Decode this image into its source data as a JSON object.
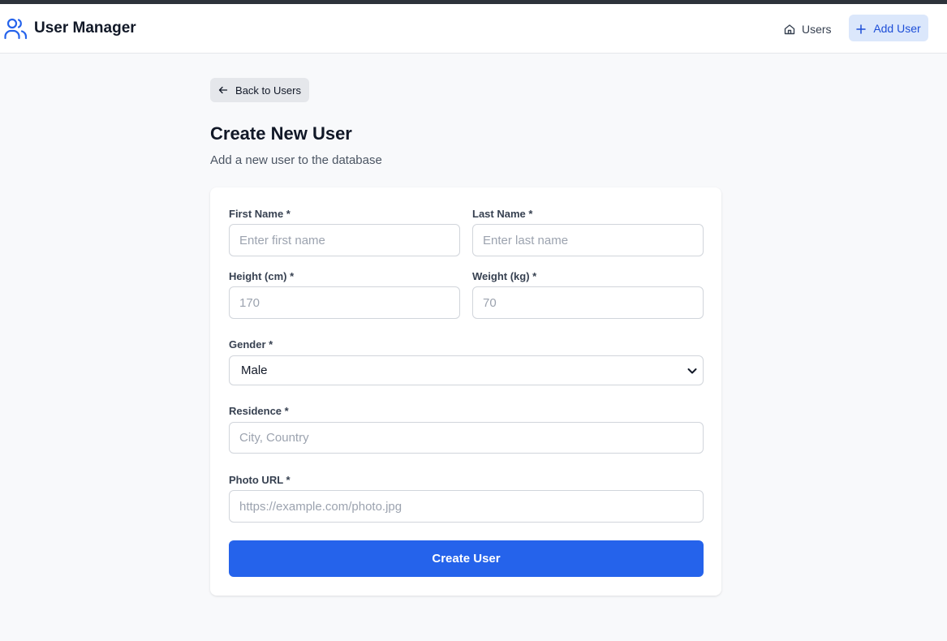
{
  "app": {
    "title": "User Manager"
  },
  "nav": {
    "users_label": "Users",
    "add_user_label": "Add User"
  },
  "page": {
    "back_label": "Back to Users",
    "title": "Create New User",
    "subtitle": "Add a new user to the database"
  },
  "form": {
    "first_name": {
      "label": "First Name *",
      "placeholder": "Enter first name",
      "value": ""
    },
    "last_name": {
      "label": "Last Name *",
      "placeholder": "Enter last name",
      "value": ""
    },
    "height": {
      "label": "Height (cm) *",
      "placeholder": "170",
      "value": ""
    },
    "weight": {
      "label": "Weight (kg) *",
      "placeholder": "70",
      "value": ""
    },
    "gender": {
      "label": "Gender *",
      "selected": "Male"
    },
    "residence": {
      "label": "Residence *",
      "placeholder": "City, Country",
      "value": ""
    },
    "photo_url": {
      "label": "Photo URL *",
      "placeholder": "https://example.com/photo.jpg",
      "value": ""
    },
    "submit_label": "Create User"
  },
  "colors": {
    "accent": "#2563eb",
    "accent_light": "#dbe7fb",
    "background": "#f8f9fb",
    "top_strip": "#2d333b"
  },
  "icons": {
    "brand": "users-icon",
    "nav_users": "home-icon",
    "nav_add": "plus-icon",
    "back": "arrow-left-icon",
    "select": "chevron-down-icon"
  }
}
